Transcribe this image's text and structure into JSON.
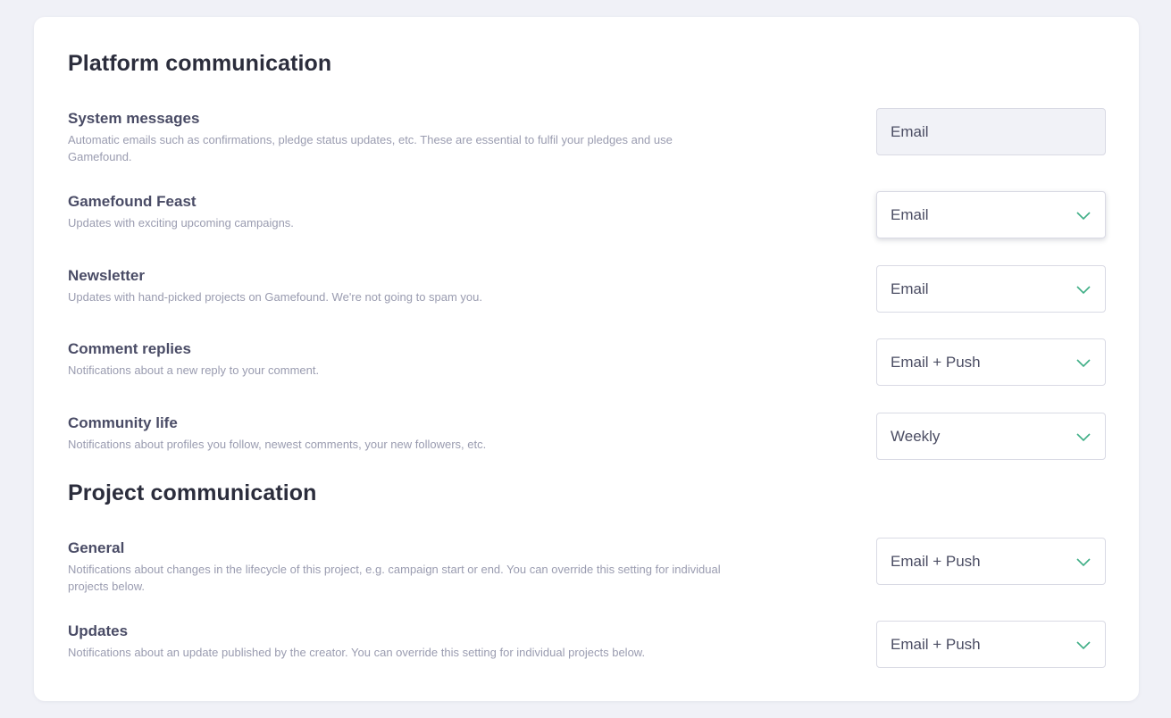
{
  "platform": {
    "title": "Platform communication",
    "rows": [
      {
        "title": "System messages",
        "desc": "Automatic emails such as confirmations, pledge status updates, etc. These are essential to fulfil your pledges and use Gamefound.",
        "value": "Email"
      },
      {
        "title": "Gamefound Feast",
        "desc": "Updates with exciting upcoming campaigns.",
        "value": "Email"
      },
      {
        "title": "Newsletter",
        "desc": "Updates with hand-picked projects on Gamefound. We're not going to spam you.",
        "value": "Email"
      },
      {
        "title": "Comment replies",
        "desc": "Notifications about a new reply to your comment.",
        "value": "Email + Push"
      },
      {
        "title": "Community life",
        "desc": "Notifications about profiles you follow, newest comments, your new followers, etc.",
        "value": "Weekly"
      }
    ]
  },
  "project": {
    "title": "Project communication",
    "rows": [
      {
        "title": "General",
        "desc": "Notifications about changes in the lifecycle of this project, e.g. campaign start or end. You can override this setting for individual projects below.",
        "value": "Email + Push"
      },
      {
        "title": "Updates",
        "desc": "Notifications about an update published by the creator. You can override this setting for individual projects below.",
        "value": "Email + Push"
      }
    ]
  },
  "colors": {
    "chevron": "#3fae86",
    "background": "#f0f1f7",
    "card": "#ffffff"
  },
  "icons": {
    "dropdown": "chevron-down-icon"
  }
}
